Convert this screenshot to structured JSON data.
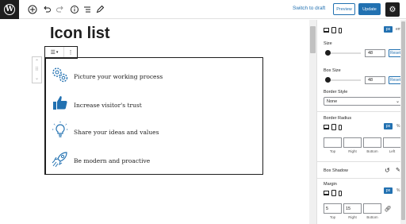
{
  "toolbar": {
    "wp_logo": "W",
    "switch_to_draft": "Switch to draft",
    "preview": "Preview",
    "update": "Update",
    "icons": [
      "wordpress-icon",
      "plus-icon",
      "undo-icon",
      "redo-icon",
      "info-icon",
      "list-view-icon",
      "pencil-icon",
      "settings-icon"
    ]
  },
  "editor": {
    "title": "Icon list",
    "block_toolbar": {
      "type_icon": "list-icon",
      "type_glyph": "☰",
      "dropdown_glyph": "▾",
      "more_glyph": "⋮"
    },
    "mover": {
      "up": "⌃",
      "drag": "⠿",
      "down": "⌄"
    },
    "items": [
      {
        "label": "Picture your working process",
        "icon": "gears-icon"
      },
      {
        "label": "Increase visitor's trust",
        "icon": "thumbs-up-icon"
      },
      {
        "label": "Share your ideas and values",
        "icon": "lightbulb-icon"
      },
      {
        "label": "Be modern and proactive",
        "icon": "rocket-icon"
      }
    ]
  },
  "sidebar": {
    "top_units": {
      "px": "px",
      "other": "em"
    },
    "size": {
      "label": "Size",
      "value": "48",
      "reset": "Reset",
      "level": 0.05
    },
    "box_size": {
      "label": "Box Size",
      "value": "48",
      "reset": "Reset",
      "level": 0.05
    },
    "border_style": {
      "label": "Border Style",
      "value": "None"
    },
    "border_radius": {
      "label": "Border Radius",
      "units": {
        "px": "px",
        "other": "%"
      },
      "values": [
        "",
        "",
        "",
        ""
      ],
      "captions": [
        "Top",
        "Right",
        "Bottom",
        "Left"
      ]
    },
    "box_shadow": {
      "label": "Box Shadow"
    },
    "margin": {
      "label": "Margin",
      "units": {
        "px": "px",
        "other": "%"
      },
      "values": [
        "5",
        "15",
        "",
        ""
      ],
      "captions": [
        "Top",
        "Right",
        "Bottom",
        "Left"
      ]
    }
  },
  "colors": {
    "accent": "#2271b1",
    "dark": "#1e1e1e",
    "icon": "#2271b1"
  }
}
